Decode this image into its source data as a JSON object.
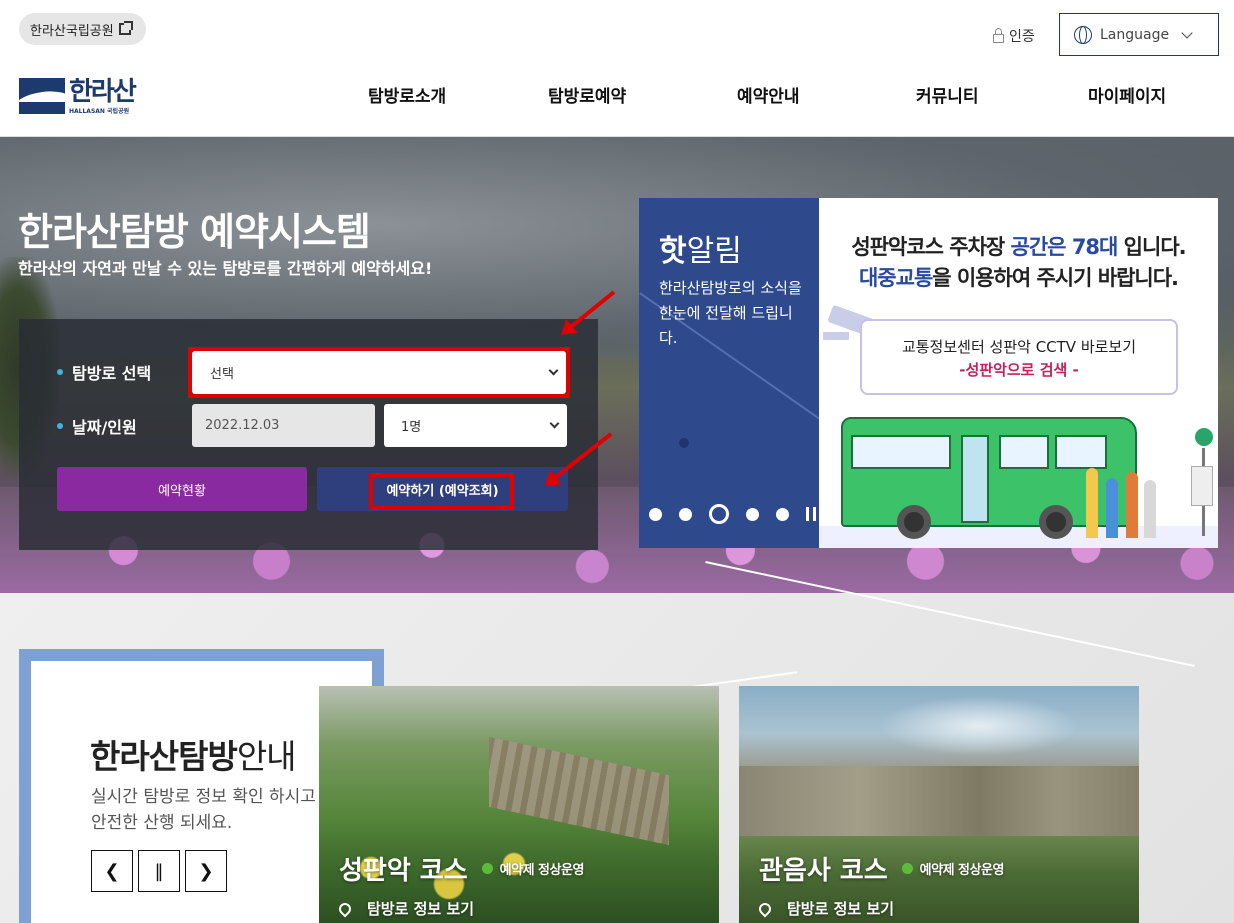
{
  "header": {
    "park_link": "한라산국립공원",
    "auth": "인증",
    "language": "Language",
    "logo_ko": "한라산",
    "logo_en": "HALLASAN 국립공원",
    "nav": [
      "탐방로소개",
      "탐방로예약",
      "예약안내",
      "커뮤니티",
      "마이페이지"
    ]
  },
  "hero": {
    "title": "한라산탐방 예약시스템",
    "subtitle": "한라산의 자연과 만날 수 있는 탐방로를 간편하게 예약하세요!"
  },
  "reservation": {
    "route_label": "탐방로 선택",
    "route_value": "선택",
    "date_label": "날짜/인원",
    "date_value": "2022.12.03",
    "people_value": "1명",
    "status_button": "예약현황",
    "reserve_button": "예약하기 (예약조회)"
  },
  "notice": {
    "head_bold": "핫",
    "head_rest": "알림",
    "text": "한라산탐방로의 소식을 한눈에 전달해 드립니다.",
    "line1_a": "성판악코스 주차장 ",
    "line1_hl": "공간은 78대",
    "line1_b": " 입니다.",
    "line2_hl": "대중교통",
    "line2_b": "을 이용하여 주시기 바랍니다.",
    "cctv_line1": "교통정보센터 성판악 CCTV 바로보기",
    "cctv_line2": "-성판악으로 검색 -",
    "slide_count": 5,
    "active_slide": 3
  },
  "info": {
    "title_bold": "한라산탐방",
    "title_rest": "안내",
    "desc1": "실시간 탐방로 정보 확인 하시고",
    "desc2": "안전한 산행 되세요.",
    "prev": "❮",
    "pause": "‖",
    "next": "❯"
  },
  "courses": [
    {
      "name": "성판악 코스",
      "status": "예약제 정상운영",
      "link": "탐방로 정보 보기"
    },
    {
      "name": "관음사 코스",
      "status": "예약제 정상운영",
      "link": "탐방로 정보 보기"
    }
  ],
  "colors": {
    "navy": "#1d3a6e",
    "purple": "#8a2aa0",
    "button_blue": "#2f3f7e",
    "annotation_red": "#e00000",
    "notice_blue": "#2f4a8c",
    "status_green": "#5dbb3b"
  }
}
